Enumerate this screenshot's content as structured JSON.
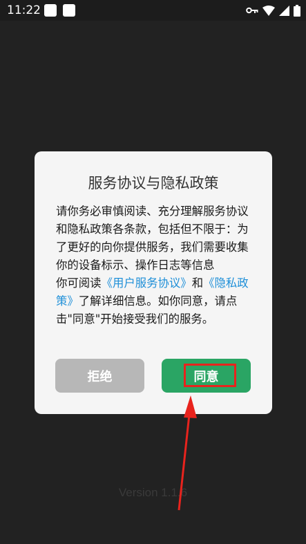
{
  "status_bar": {
    "time": "11:22",
    "icons": [
      "notification-square-icon",
      "notification-square-icon",
      "vpn-key-icon",
      "wifi-icon",
      "signal-icon",
      "battery-icon"
    ]
  },
  "dialog": {
    "title": "服务协议与隐私政策",
    "body_intro": "请你务必审慎阅读、充分理解服务协议和隐私政策各条款，包括但不限于：为了更好的向你提供服务，我们需要收集你的设备标示、操作日志等信息",
    "read_prefix": "你可阅读",
    "user_agreement_link": "《用户服务协议》",
    "and": "和",
    "privacy_link": "《隐私政策》",
    "read_suffix": "了解详细信息。如你同意，请点击\"同意\"开始接受我们的服务。",
    "reject_label": "拒绝",
    "agree_label": "同意"
  },
  "version_text": "Version 1.1.6",
  "colors": {
    "agree_button": "#2aa564",
    "reject_button": "#b7b7b7",
    "link": "#1e8fd8",
    "annotation": "#e8231d"
  }
}
